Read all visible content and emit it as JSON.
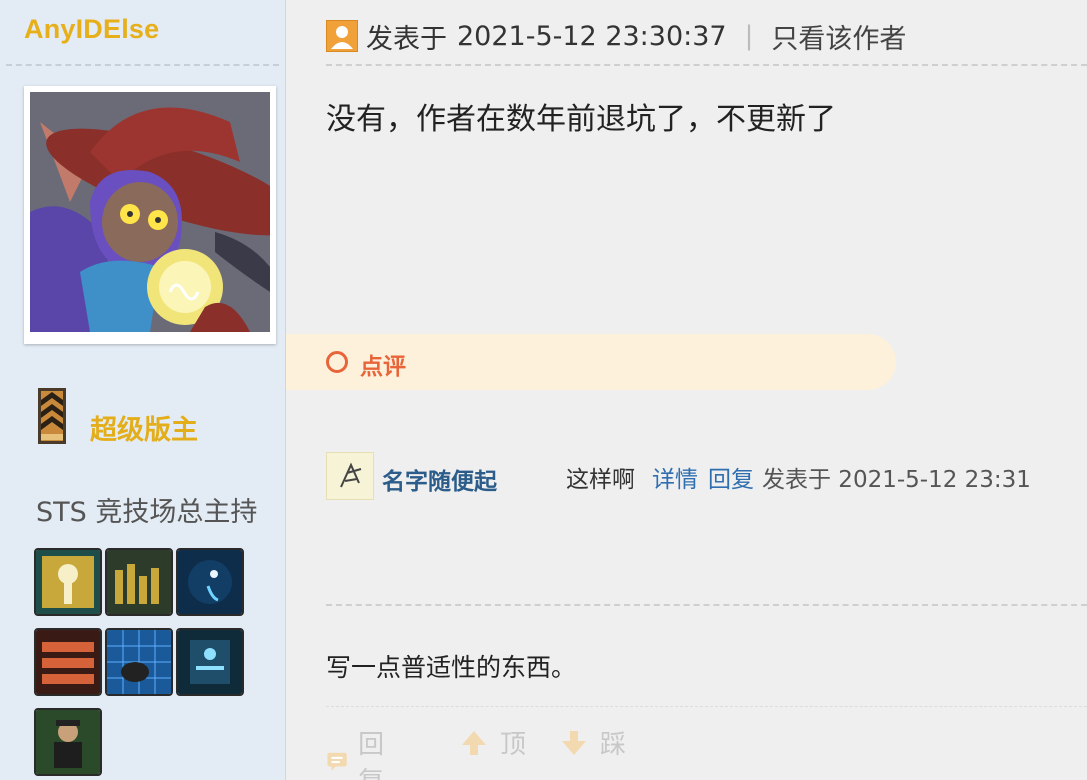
{
  "author": {
    "name": "AnyIDElse",
    "group": "超级版主",
    "custom_title": "STS 竞技场总主持"
  },
  "post": {
    "prefix": "发表于",
    "timestamp": "2021-5-12 23:30:37",
    "only_author": "只看该作者",
    "body": "没有，作者在数年前退坑了，不更新了",
    "signature": "写一点普适性的东西。"
  },
  "comments_section": {
    "label": "点评",
    "items": [
      {
        "user": "名字随便起",
        "text": "这样啊",
        "detail": "详情",
        "reply": "回复",
        "time": "发表于 2021-5-12 23:31"
      }
    ]
  },
  "actions": {
    "reply": "回复",
    "up": "顶",
    "down": "踩"
  },
  "colors": {
    "username": "#e7b01a",
    "group": "#e3ae1a",
    "comment_accent": "#e8653a",
    "link": "#2f6fb0",
    "sidebar_bg": "#e3ebf4"
  }
}
